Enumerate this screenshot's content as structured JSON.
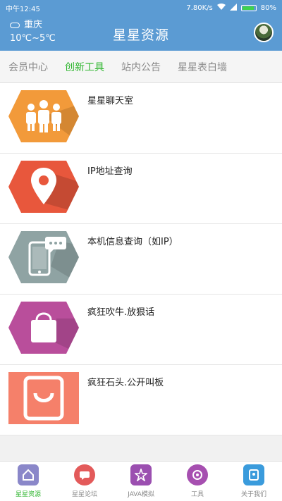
{
  "status_bar": {
    "time": "中午12:45",
    "network_speed": "7.80K/s",
    "battery": "80%"
  },
  "header": {
    "city": "重庆",
    "temperature": "10℃~5℃",
    "title": "星星资源"
  },
  "tabs": [
    {
      "label": "会员中心",
      "active": false
    },
    {
      "label": "创新工具",
      "active": true
    },
    {
      "label": "站内公告",
      "active": false
    },
    {
      "label": "星星表白墙",
      "active": false
    }
  ],
  "list": [
    {
      "label": "星星聊天室",
      "icon": "people-icon",
      "color": "#f29a3a"
    },
    {
      "label": "IP地址查询",
      "icon": "location-pin-icon",
      "color": "#e8573c"
    },
    {
      "label": "本机信息查询（如IP）",
      "icon": "phone-chat-icon",
      "color": "#8fa3a3"
    },
    {
      "label": "疯狂吹牛.放狠话",
      "icon": "shopping-bag-icon",
      "color": "#b94e9b"
    },
    {
      "label": "疯狂石头.公开叫板",
      "icon": "shopping-bag-icon",
      "color": "#f5806a"
    }
  ],
  "bottom_nav": [
    {
      "label": "星星资源",
      "icon": "home-icon",
      "color": "#8a87c9",
      "active": true
    },
    {
      "label": "星星论坛",
      "icon": "chat-icon",
      "color": "#e35a5a",
      "active": false
    },
    {
      "label": "JAVA模拟",
      "icon": "star-icon",
      "color": "#9b4fb0",
      "active": false
    },
    {
      "label": "工具",
      "icon": "tool-icon",
      "color": "#a64fb0",
      "active": false
    },
    {
      "label": "关于我们",
      "icon": "info-icon",
      "color": "#3a9bdc",
      "active": false
    }
  ]
}
